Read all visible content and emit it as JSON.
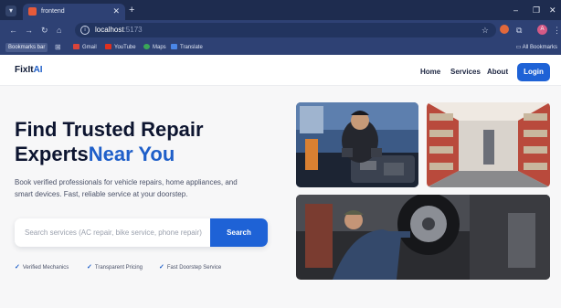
{
  "browser": {
    "tab_title": "frontend",
    "url_host": "localhost",
    "url_port": ":5173",
    "bookmarks_bar_label": "Bookmarks bar",
    "bookmarks": [
      "Gmail",
      "YouTube",
      "Maps",
      "Translate"
    ],
    "all_bookmarks": "All Bookmarks",
    "avatar_initial": "A"
  },
  "site": {
    "logo_main": "FixIt",
    "logo_accent": "AI",
    "nav": [
      "Home",
      "Services",
      "About"
    ],
    "login_label": "Login"
  },
  "hero": {
    "title_line1": "Find Trusted Repair",
    "title_line2": "Experts",
    "title_accent": "Near You",
    "description": "Book verified professionals for vehicle repairs, home appliances, and smart devices. Fast, reliable service at your doorstep.",
    "search_placeholder": "Search services (AC repair, bike service, phone repair)",
    "search_button": "Search",
    "features": [
      "Verified Mechanics",
      "Transparent Pricing",
      "Fast Doorstep Service"
    ]
  },
  "colors": {
    "brand": "#1e62d6",
    "chrome": "#2e4174",
    "heading": "#0d1530"
  }
}
